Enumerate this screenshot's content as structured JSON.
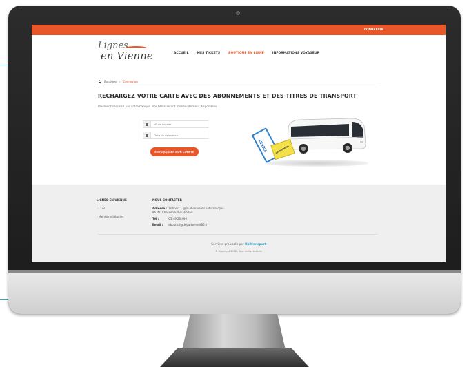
{
  "topbar": {
    "connect_label": "CONNEXION"
  },
  "brand": {
    "line1": "Lignes",
    "line2": "en Vienne"
  },
  "nav": [
    {
      "label": "ACCUEIL"
    },
    {
      "label": "MES TICKETS"
    },
    {
      "label": "BOUTIQUE EN LIGNE",
      "active": true
    },
    {
      "label": "INFORMATIONS VOYAGEUR"
    }
  ],
  "breadcrumb": {
    "home": "Boutique",
    "separator": "›",
    "current": "Connexion"
  },
  "page": {
    "title": "RECHARGEZ VOTRE CARTE AVEC DES ABONNEMENTS ET DES TITRES DE TRANSPORT",
    "subtitle": "Paiement sécurisé par votre banque. Vos titres seront immédiatement disponibles"
  },
  "form": {
    "file_number_placeholder": "N° de dossier",
    "birth_date_placeholder": "Date de naissance",
    "submit_label": "ENVOI(G)SSER MON COMPTE"
  },
  "illustration": {
    "ticket_a_text": "TICKET",
    "ticket_b_text": "ABONNEMENT"
  },
  "footer": {
    "col1_heading": "LIGNES EN VIENNE",
    "links": [
      "CGV",
      "Mentions Légales"
    ],
    "col2_heading": "NOUS CONTACTER",
    "address_label": "Adresse :",
    "address_value": "Téléport 1 @3 - Avenue du Futuroscope -",
    "address_line2": "86360 Chasseneuil-du-Poitou",
    "tel_label": "Tél :",
    "tel_value": "05 49 26 490",
    "email_label": "Email :",
    "email_value": "ebouticli@departement86.fr",
    "services_text": "Services proposés par",
    "services_brand": "Ubitransport",
    "copyright": "© Copyright 2018 - Tous droits réservés"
  },
  "colors": {
    "accent": "#e8572a",
    "brand_blue": "#2aa7c9",
    "footer_bg": "#efefef"
  },
  "icons": [
    "home-icon",
    "user-icon",
    "calendar-icon",
    "bus-icon"
  ]
}
